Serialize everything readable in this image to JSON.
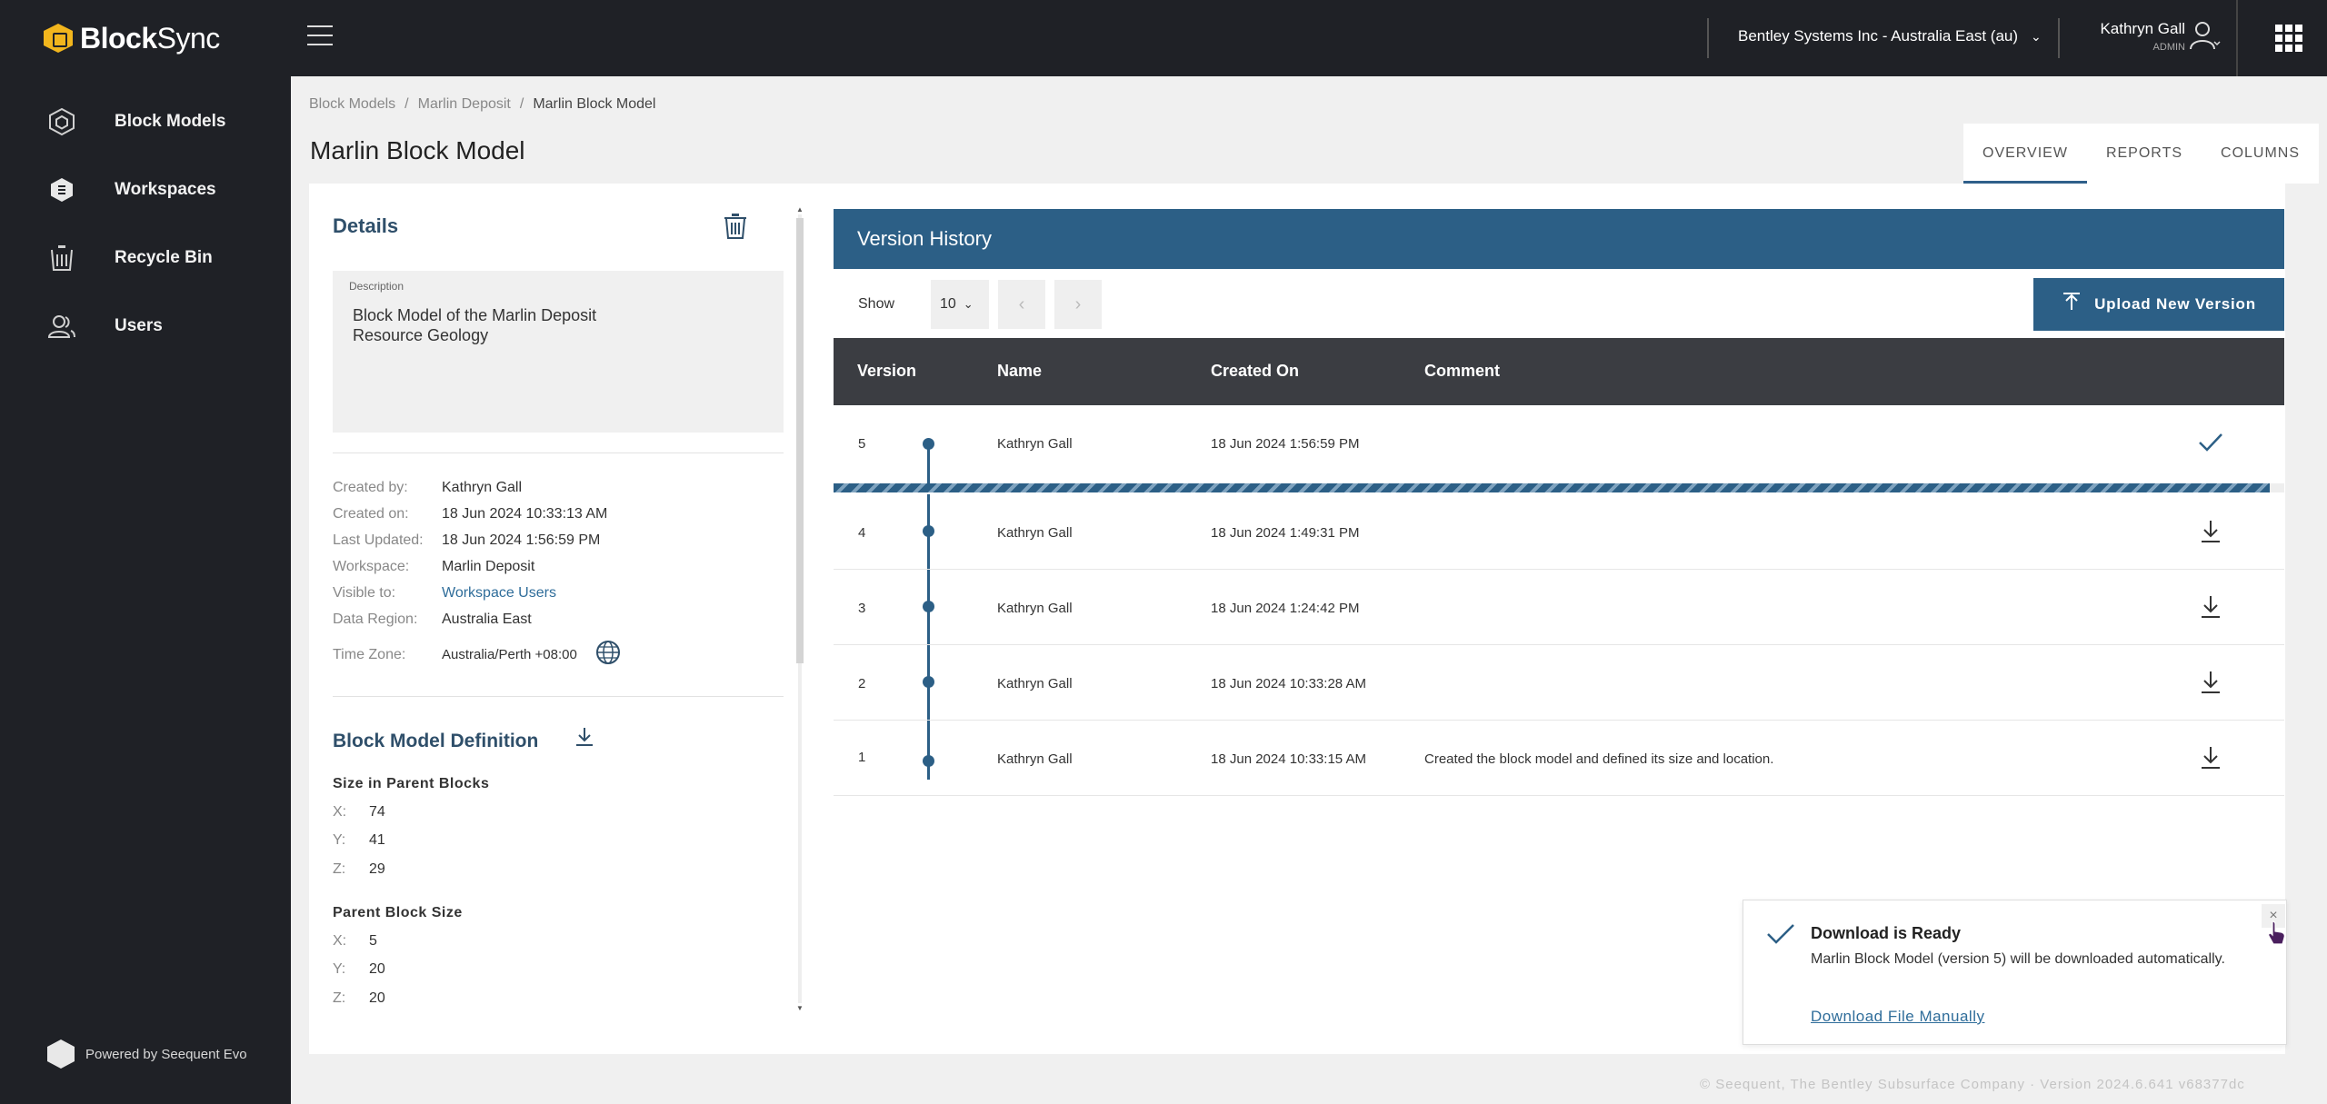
{
  "app": {
    "logo_bold": "Block",
    "logo_rest": "Sync",
    "powered_by": "Powered by Seequent Evo"
  },
  "sidebar": {
    "items": [
      {
        "label": "Block Models",
        "icon": "block-models-icon"
      },
      {
        "label": "Workspaces",
        "icon": "workspaces-icon"
      },
      {
        "label": "Recycle Bin",
        "icon": "recycle-bin-icon"
      },
      {
        "label": "Users",
        "icon": "users-icon"
      }
    ]
  },
  "topbar": {
    "org": "Bentley Systems Inc - Australia East (au)",
    "user_name": "Kathryn Gall",
    "user_role": "ADMIN"
  },
  "breadcrumb": [
    "Block Models",
    "Marlin Deposit",
    "Marlin Block Model"
  ],
  "page": {
    "title": "Marlin Block Model",
    "tabs": [
      "OVERVIEW",
      "REPORTS",
      "COLUMNS"
    ],
    "active_tab": "OVERVIEW"
  },
  "details": {
    "title": "Details",
    "description_label": "Description",
    "description": "Block Model of the Marlin Deposit Resource Geology",
    "meta": [
      {
        "key": "Created by:",
        "value": "Kathryn Gall"
      },
      {
        "key": "Created on:",
        "value": "18 Jun 2024 10:33:13 AM"
      },
      {
        "key": "Last Updated:",
        "value": "18 Jun 2024 1:56:59 PM"
      },
      {
        "key": "Workspace:",
        "value": "Marlin Deposit"
      },
      {
        "key": "Visible to:",
        "value": "Workspace Users"
      },
      {
        "key": "Data Region:",
        "value": "Australia East"
      },
      {
        "key": "Time Zone:",
        "value": "Australia/Perth +08:00"
      }
    ],
    "definition_title": "Block Model Definition",
    "size_title": "Size in Parent Blocks",
    "size": [
      {
        "k": "X:",
        "v": "74"
      },
      {
        "k": "Y:",
        "v": "41"
      },
      {
        "k": "Z:",
        "v": "29"
      }
    ],
    "block_size_title": "Parent Block Size",
    "block_size": [
      {
        "k": "X:",
        "v": "5"
      },
      {
        "k": "Y:",
        "v": "20"
      },
      {
        "k": "Z:",
        "v": "20"
      }
    ]
  },
  "version_history": {
    "title": "Version History",
    "show_label": "Show",
    "page_size": "10",
    "upload_label": "Upload New Version",
    "columns": [
      "Version",
      "Name",
      "Created On",
      "Comment"
    ],
    "rows": [
      {
        "version": "5",
        "name": "Kathryn Gall",
        "created": "18 Jun 2024 1:56:59 PM",
        "comment": "",
        "action": "check-icon"
      },
      {
        "version": "4",
        "name": "Kathryn Gall",
        "created": "18 Jun 2024 1:49:31 PM",
        "comment": "",
        "action": "download-icon"
      },
      {
        "version": "3",
        "name": "Kathryn Gall",
        "created": "18 Jun 2024 1:24:42 PM",
        "comment": "",
        "action": "download-icon"
      },
      {
        "version": "2",
        "name": "Kathryn Gall",
        "created": "18 Jun 2024 10:33:28 AM",
        "comment": "",
        "action": "download-icon"
      },
      {
        "version": "1",
        "name": "Kathryn Gall",
        "created": "18 Jun 2024 10:33:15 AM",
        "comment": "Created the block model and defined its size and location.",
        "action": "download-icon"
      }
    ],
    "progress": 0.99
  },
  "toast": {
    "title": "Download is Ready",
    "message": "Marlin Block Model (version 5) will be downloaded automatically.",
    "link": "Download File Manually",
    "close": "×"
  },
  "footer": "© Seequent, The Bentley Subsurface Company · Version 2024.6.641 v68377dc",
  "colors": {
    "accent": "#2c5f86",
    "sidebar": "#1f2126",
    "logo": "#f2b61d"
  }
}
